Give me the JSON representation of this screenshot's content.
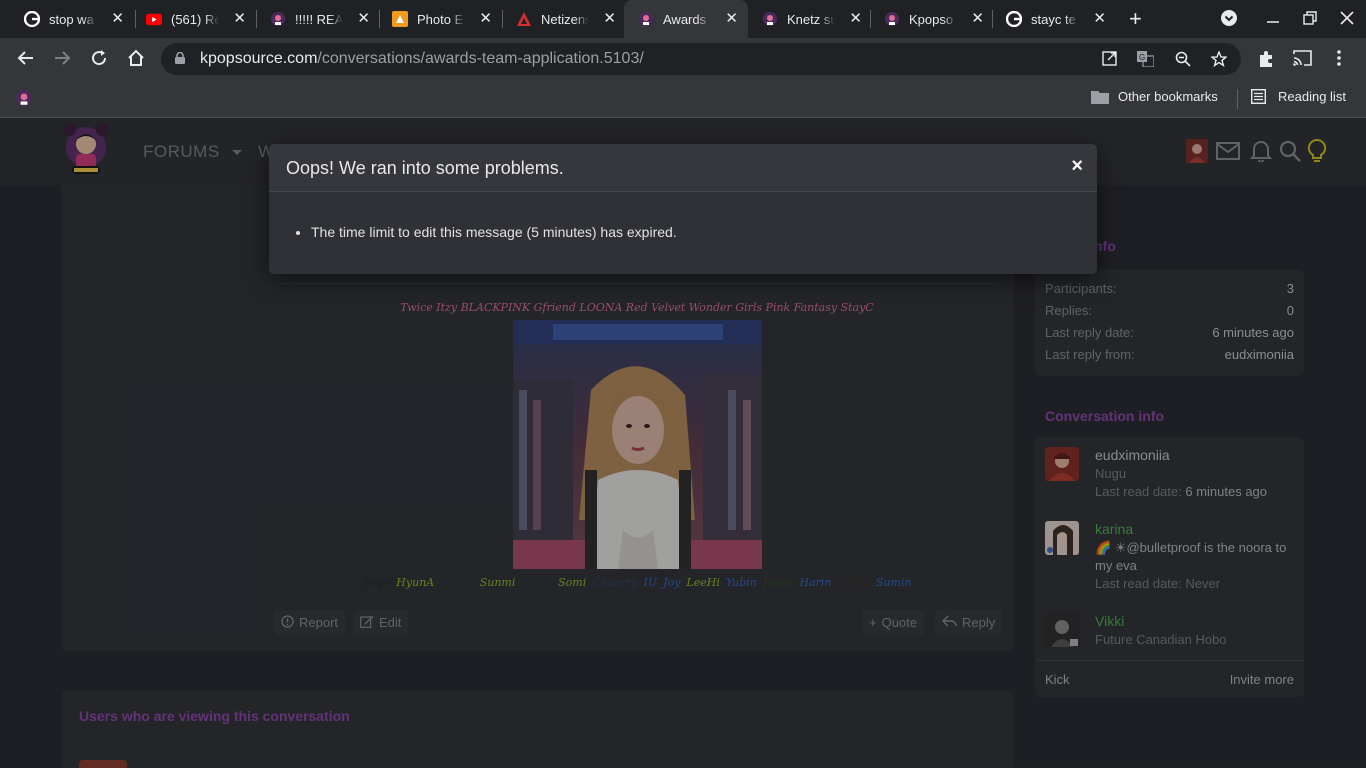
{
  "browser": {
    "tabs": [
      {
        "title": "stop wa",
        "icon": "google-icon"
      },
      {
        "title": "(561) Re",
        "icon": "youtube-icon"
      },
      {
        "title": "!!!!! REAL",
        "icon": "kpopsource-icon"
      },
      {
        "title": "Photo E",
        "icon": "photo-editor-icon"
      },
      {
        "title": "Netizens",
        "icon": "netizenbuzz-icon"
      },
      {
        "title": "Awards",
        "icon": "kpopsource-icon",
        "active": true
      },
      {
        "title": "Knetz su",
        "icon": "kpopsource-icon"
      },
      {
        "title": "Kpopso",
        "icon": "kpopsource-icon"
      },
      {
        "title": "stayc te",
        "icon": "google-icon"
      }
    ],
    "url_host": "kpopsource.com",
    "url_path": "/conversations/awards-team-application.5103/",
    "bookmarks": {
      "other": "Other bookmarks",
      "reading_list": "Reading list"
    }
  },
  "site": {
    "nav": {
      "forums": "FORUMS",
      "next_partial": "W"
    }
  },
  "modal": {
    "title": "Oops! We ran into some problems.",
    "errors": [
      "The time limit to edit this message (5 minutes) has expired."
    ],
    "close_symbol": "×"
  },
  "post": {
    "signature_groups": "Twice Itzy BLACKPINK Gfriend LOONA Red Velvet Wonder Girls Pink Fantasy StayC",
    "signature_names": [
      {
        "name": "Jihyo",
        "color": "#23252a"
      },
      {
        "name": "HyunA",
        "color": "#8fbf1f"
      },
      {
        "name": "Yeeun",
        "color": "#2a2c31"
      },
      {
        "name": "Sunmi",
        "color": "#8fbf1f"
      },
      {
        "name": "Seola",
        "color": "#2a2c31"
      },
      {
        "name": "Somi",
        "color": "#8fbf1f"
      },
      {
        "name": "Chaerry",
        "color": "#2e3f66"
      },
      {
        "name": "IU",
        "color": "#2e66c8"
      },
      {
        "name": "Joy",
        "color": "#2e66c8"
      },
      {
        "name": "LeeHi",
        "color": "#8fbf1f"
      },
      {
        "name": "Yubin",
        "color": "#2e66c8"
      },
      {
        "name": "Jiwoo",
        "color": "#2f4a1e"
      },
      {
        "name": "Harin",
        "color": "#2e66c8"
      },
      {
        "name": "AleXa",
        "color": "#3a2f22"
      },
      {
        "name": "Sumin",
        "color": "#2e66c8"
      }
    ],
    "actions": {
      "report": "Report",
      "edit": "Edit",
      "quote": "Quote",
      "reply": "Reply"
    }
  },
  "viewers": {
    "title": "Users who are viewing this conversation"
  },
  "sidebar": {
    "info_title_partial": "sation info",
    "info": {
      "participants_label": "Participants:",
      "participants_value": "3",
      "replies_label": "Replies:",
      "replies_value": "0",
      "last_reply_date_label": "Last reply date:",
      "last_reply_date_value": "6 minutes ago",
      "last_reply_from_label": "Last reply from:",
      "last_reply_from_value": "eudximoniia"
    },
    "participants_title": "Conversation info",
    "participants": [
      {
        "name": "eudximoniia",
        "name_color": "#c9ccd1",
        "line1": "Nugu",
        "line2_label": "Last read date:",
        "line2_value": "6 minutes ago"
      },
      {
        "name": "karina",
        "name_color": "#4caf50",
        "line1": "🌈 ☀@bulletproof is the noora to",
        "line1b": "my eva",
        "line2_label": "Last read date:",
        "line2_value": "Never"
      },
      {
        "name": "Vikki",
        "name_color": "#4caf50",
        "line1": "Future Canadian Hobo"
      }
    ],
    "kick": "Kick",
    "invite_more": "Invite more"
  }
}
